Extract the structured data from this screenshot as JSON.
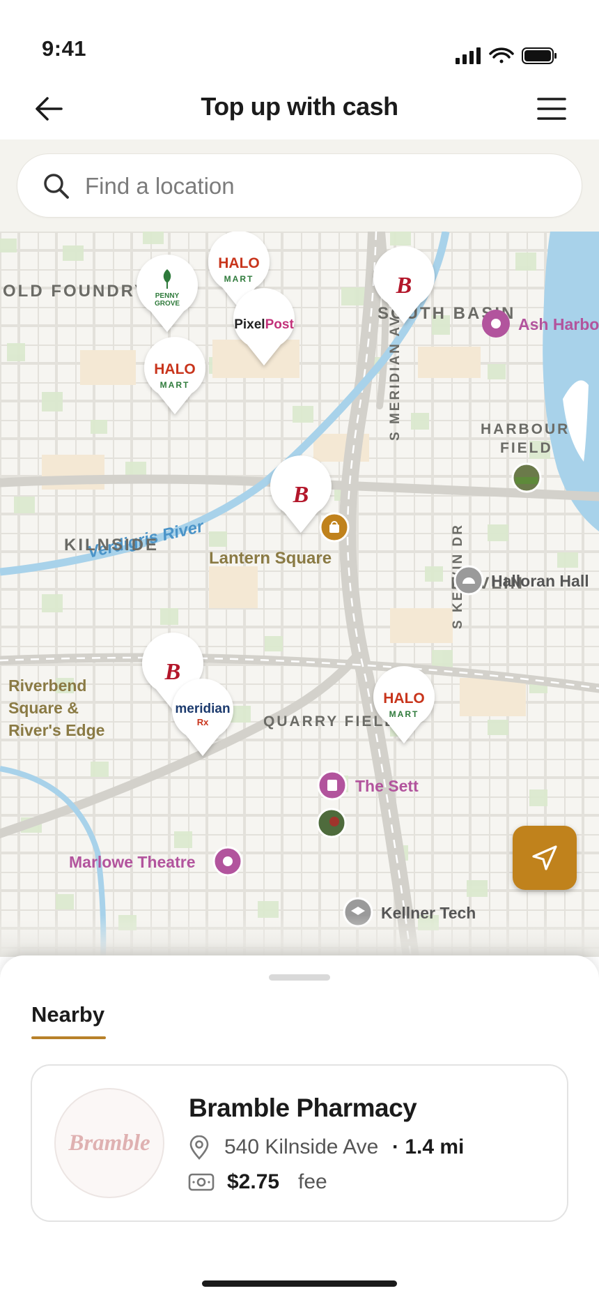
{
  "status": {
    "time": "9:41"
  },
  "header": {
    "title": "Top up with cash"
  },
  "search": {
    "placeholder": "Find a location"
  },
  "map": {
    "areas": [
      "OLD FOUNDRY",
      "SOUTH BASIN",
      "HARBOUR",
      "FIELD",
      "KILNSIDE",
      "DEVLIN",
      "QUARRY FIELD"
    ],
    "streets": [
      "S MERIDIAN AV",
      "S KELVIN DR"
    ],
    "river": "Verdigris River",
    "places": {
      "ash_harbour": "Ash Harbo",
      "lantern_square": "Lantern Square",
      "halloran_hall": "Halloran Hall",
      "riverbend": [
        "Riverbend",
        "Square &",
        "River's Edge"
      ],
      "the_sett": "The Sett",
      "marlowe_theatre": "Marlowe Theatre",
      "kellner_tech": "Kellner Tech"
    },
    "pins": {
      "halo": {
        "line1": "HALO",
        "line2": "MART"
      },
      "penny": {
        "line1": "PENNY",
        "line2": "GROVE"
      },
      "pixelpost": {
        "part1": "Pixel",
        "part2": "Post"
      },
      "bramble": "B",
      "meridian": {
        "line1": "meridian",
        "line2": "Rx"
      }
    }
  },
  "sheet": {
    "tab": "Nearby",
    "card": {
      "logo_text": "Bramble",
      "name": "Bramble Pharmacy",
      "address": "540 Kilnside Ave",
      "distance": "· 1.4 mi",
      "fee": "$2.75",
      "fee_label": "fee"
    }
  },
  "colors": {
    "accent": "#c0821c",
    "halo_red": "#c8341e",
    "bramble_red": "#b3182a",
    "poi_purple": "#b2549d",
    "river": "#a8d2ea"
  }
}
